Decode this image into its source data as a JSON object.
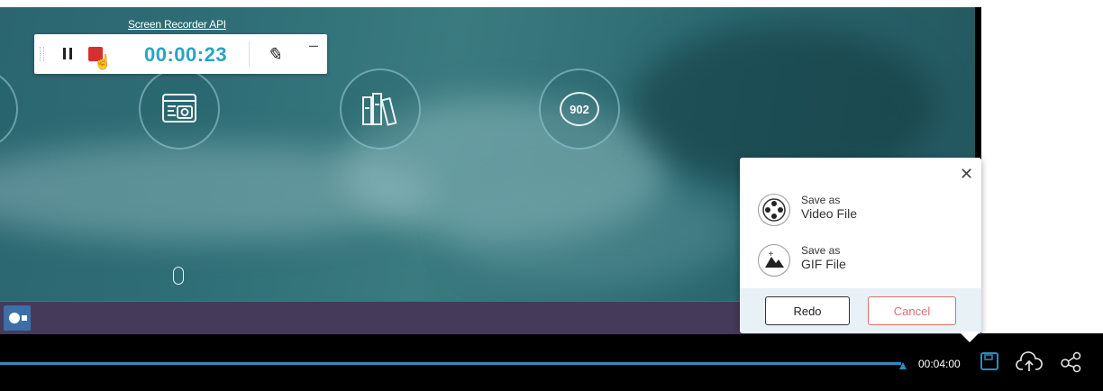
{
  "video": {
    "api_link": "Screen Recorder API",
    "badge_count": "902"
  },
  "recorder": {
    "time": "00:00:23"
  },
  "save_popup": {
    "options": [
      {
        "line1": "Save as",
        "line2": "Video File",
        "icon": "film-reel-icon"
      },
      {
        "line1": "Save as",
        "line2": "GIF File",
        "icon": "image-mountain-icon"
      }
    ],
    "redo_label": "Redo",
    "cancel_label": "Cancel"
  },
  "playback": {
    "end_time": "00:04:00",
    "progress": 0.98
  },
  "colors": {
    "accent": "#2aa3c4",
    "stop": "#d62f2f",
    "cancel": "#e06e6e",
    "timeline": "#2d8cc0"
  }
}
